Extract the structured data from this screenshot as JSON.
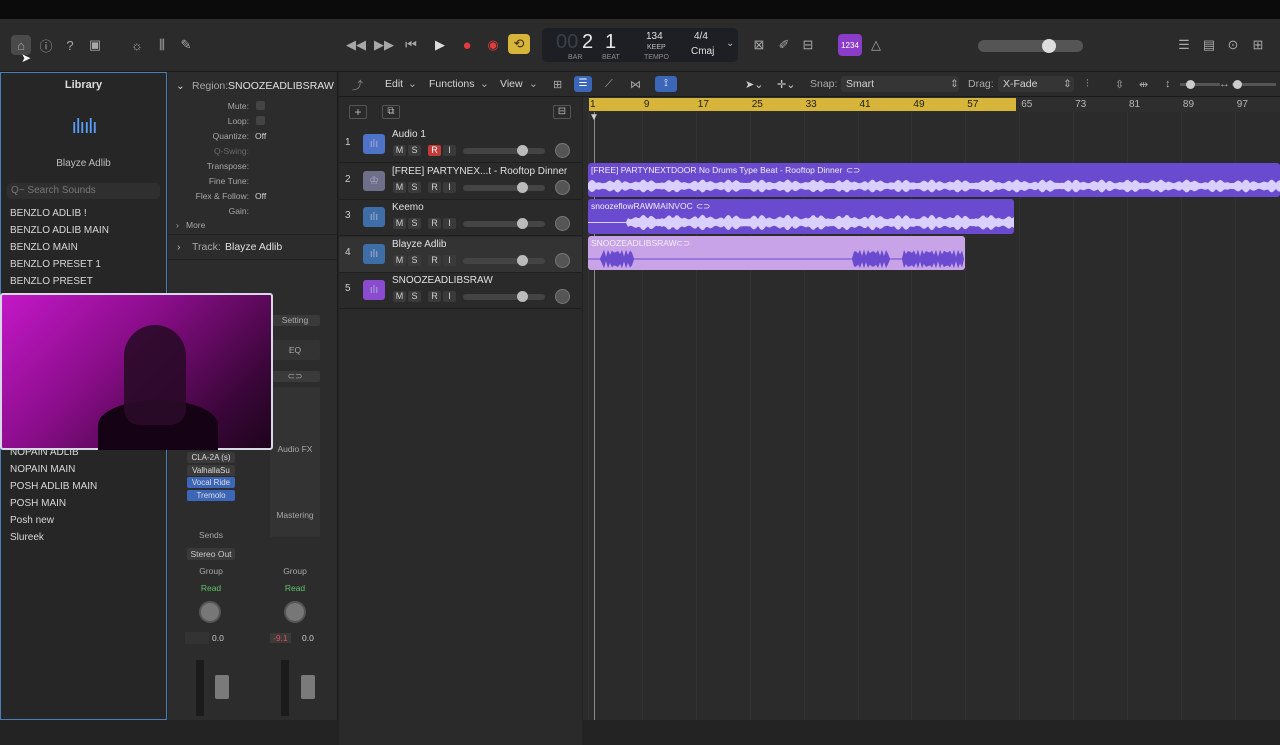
{
  "toolbar": {
    "lcd": {
      "bar": "2",
      "beat": "1",
      "bar_label": "BAR",
      "beat_label": "BEAT",
      "tempo": "134",
      "keep": "KEEP",
      "tempo_label": "TEMPO",
      "signature": "4/4",
      "key": "Cmaj",
      "faint": "00"
    },
    "count_in": "1234"
  },
  "library": {
    "title": "Library",
    "patch_name": "Blayze Adlib",
    "search_placeholder": "Q~ Search Sounds",
    "items_top": [
      "BENZLO ADLIB !",
      "BENZLO ADLIB MAIN",
      "BENZLO MAIN",
      "BENZLO PRESET 1",
      "BENZLO PRESET"
    ],
    "items_bottom": [
      "NOPAIN ADLIB",
      "NOPAIN MAIN",
      "POSH ADLIB MAIN",
      "POSH MAIN",
      "Posh new",
      "Slureek"
    ]
  },
  "inspector": {
    "region_label": "Region:",
    "region_name": "SNOOZEADLIBSRAW",
    "rows": [
      {
        "label": "Mute:",
        "value": ""
      },
      {
        "label": "Loop:",
        "value": ""
      },
      {
        "label": "Quantize:",
        "value": "Off"
      },
      {
        "label": "Q-Swing:",
        "value": ""
      },
      {
        "label": "Transpose:",
        "value": ""
      },
      {
        "label": "Fine Tune:",
        "value": ""
      },
      {
        "label": "Flex & Follow:",
        "value": "Off"
      },
      {
        "label": "Gain:",
        "value": ""
      }
    ],
    "more": "More",
    "track_label": "Track:",
    "track_name": "Blayze Adlib",
    "setting": "Setting",
    "eq": "EQ",
    "audio_fx": "Audio FX",
    "mastering": "Mastering",
    "plugins": [
      "CLA-2A (s)",
      "ValhallaSu",
      "Vocal Ride",
      "Tremolo"
    ],
    "sends": "Sends",
    "output": "Stereo Out",
    "group1": "Group",
    "group2": "Group",
    "read1": "Read",
    "read2": "Read",
    "val1": "0.0",
    "val2a": "-9.1",
    "val2b": "0.0"
  },
  "menus": {
    "edit": "Edit",
    "functions": "Functions",
    "view": "View",
    "snap_label": "Snap:",
    "snap_value": "Smart",
    "drag_label": "Drag:",
    "drag_value": "X-Fade"
  },
  "tracks": [
    {
      "num": "1",
      "name": "Audio 1",
      "rec": true
    },
    {
      "num": "2",
      "name": "[FREE] PARTYNEX...t - Rooftop Dinner",
      "rec": false
    },
    {
      "num": "3",
      "name": "Keemo",
      "rec": false
    },
    {
      "num": "4",
      "name": "Blayze Adlib",
      "rec": false
    },
    {
      "num": "5",
      "name": "SNOOZEADLIBSRAW",
      "rec": false
    }
  ],
  "msri": [
    "M",
    "S",
    "R",
    "I"
  ],
  "ruler": [
    "1",
    "9",
    "17",
    "25",
    "33",
    "41",
    "49",
    "57",
    "65",
    "73",
    "81",
    "89",
    "97"
  ],
  "regions": [
    {
      "name": "[FREE] PARTYNEXTDOOR No Drums Type Beat - Rooftop Dinner"
    },
    {
      "name": "snoozeflowRAWMAINVOC"
    },
    {
      "name": "SNOOZEADLIBSRAW"
    }
  ],
  "colors": {
    "accent": "#d7b53a",
    "region_purple": "#6a4bd0",
    "region_light": "#c9a3e8",
    "record": "#e03c3c",
    "cycle": "#d7b53a"
  }
}
